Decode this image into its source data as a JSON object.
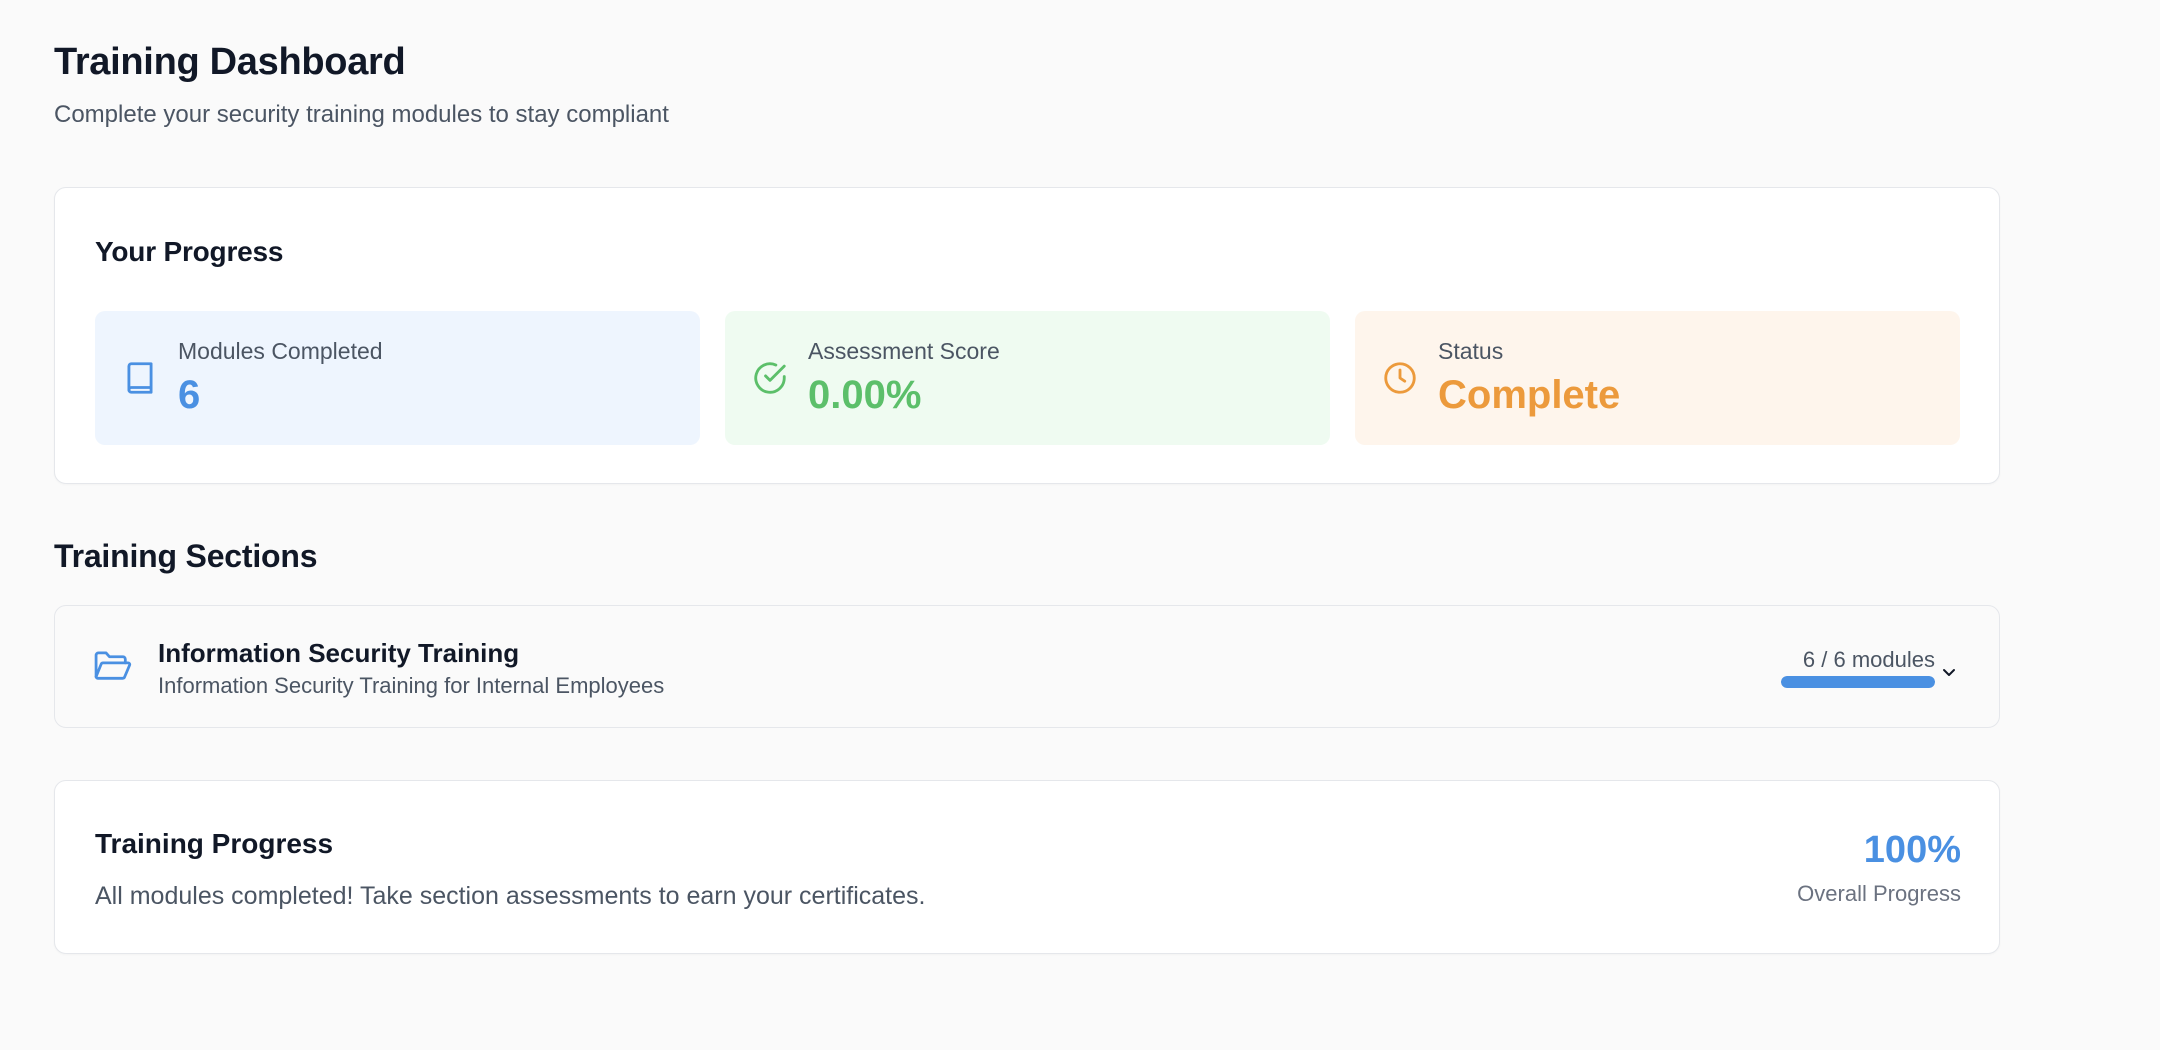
{
  "header": {
    "title": "Training Dashboard",
    "subtitle": "Complete your security training modules to stay compliant"
  },
  "progress": {
    "title": "Your Progress",
    "stats": [
      {
        "label": "Modules Completed",
        "value": "6",
        "icon": "book-icon",
        "color": "#4a90e2"
      },
      {
        "label": "Assessment Score",
        "value": "0.00%",
        "icon": "check-circle-icon",
        "color": "#5cbf6a"
      },
      {
        "label": "Status",
        "value": "Complete",
        "icon": "clock-icon",
        "color": "#ec9a3c"
      }
    ]
  },
  "sections": {
    "heading": "Training Sections",
    "items": [
      {
        "title": "Information Security Training",
        "description": "Information Security Training for Internal Employees",
        "module_count": "6 / 6 modules",
        "progress_fraction": 1.0,
        "icon": "folder-open-icon"
      }
    ]
  },
  "training_progress": {
    "title": "Training Progress",
    "message": "All modules completed! Take section assessments to earn your certificates.",
    "percent": "100%",
    "percent_label": "Overall Progress"
  },
  "colors": {
    "accent": "#4a90e2",
    "success": "#5cbf6a",
    "warning": "#ec9a3c"
  }
}
